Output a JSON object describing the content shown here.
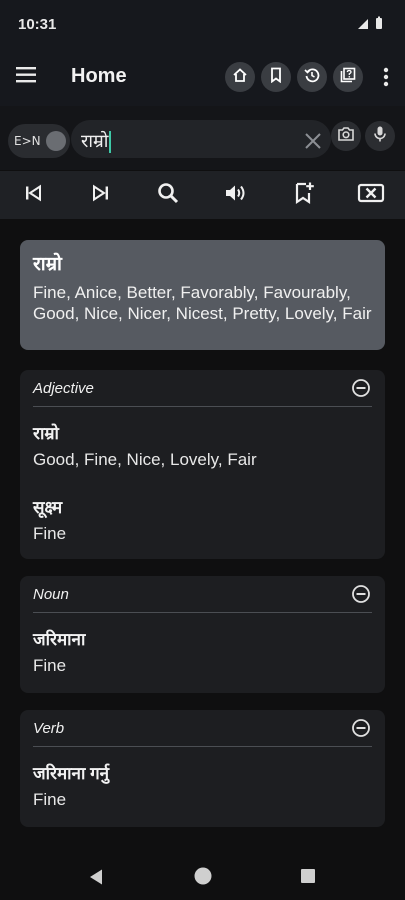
{
  "status": {
    "time": "10:31"
  },
  "appbar": {
    "title": "Home",
    "buttons": [
      "home-icon",
      "bookmark-icon",
      "history-icon",
      "quiz-icon"
    ]
  },
  "search": {
    "toggle_label": "E>N",
    "query": "राम्रो"
  },
  "toolbar": [
    "skip-back-icon",
    "skip-forward-icon",
    "search-icon",
    "speaker-icon",
    "bookmark-add-icon",
    "delete-icon"
  ],
  "hero": {
    "word": "राम्रो",
    "definitions": "Fine, Anice, Better, Favorably, Favourably, Good, Nice, Nicer, Nicest, Pretty, Lovely, Fair"
  },
  "sections": [
    {
      "pos": "Adjective",
      "entries": [
        {
          "word": "राम्रो",
          "defs": "Good, Fine, Nice, Lovely, Fair"
        },
        {
          "word": "सूक्ष्म",
          "defs": "Fine"
        }
      ]
    },
    {
      "pos": "Noun",
      "entries": [
        {
          "word": "जरिमाना",
          "defs": "Fine"
        }
      ]
    },
    {
      "pos": "Verb",
      "entries": [
        {
          "word": "जरिमाना गर्नु",
          "defs": "Fine"
        }
      ]
    }
  ],
  "colors": {
    "accent": "#3ec9a7",
    "hero_bg": "#565a61",
    "card_bg": "#1d1e21"
  }
}
